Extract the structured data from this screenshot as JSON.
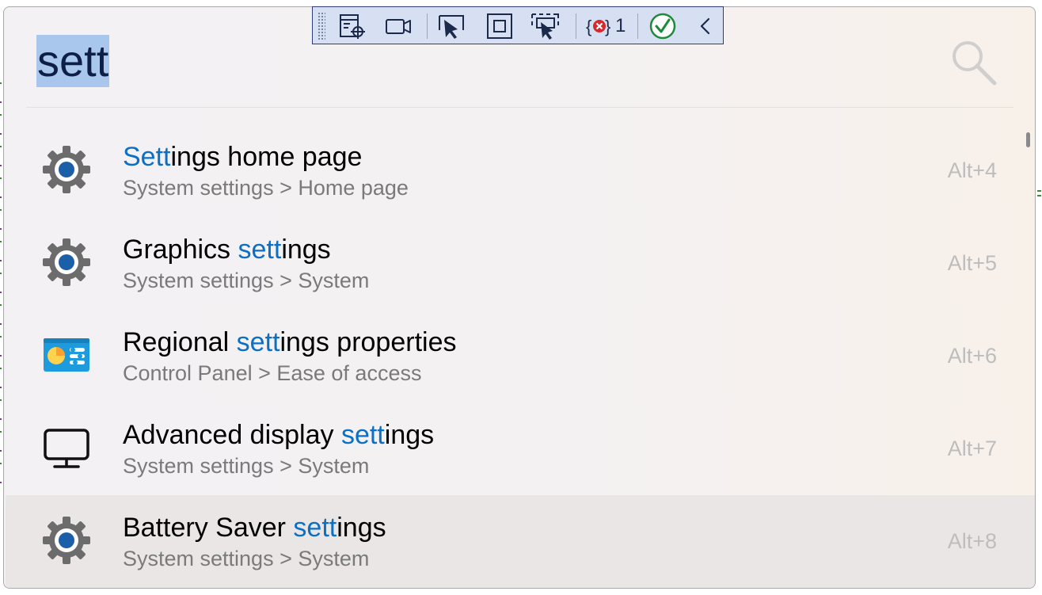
{
  "search": {
    "query": "sett"
  },
  "results": [
    {
      "title_match": "Sett",
      "title_rest": "ings home page",
      "subtitle": "System settings > Home page",
      "shortcut": "Alt+4",
      "icon": "gear-icon"
    },
    {
      "title_pre": "Graphics ",
      "title_match": "sett",
      "title_rest": "ings",
      "subtitle": "System settings > System",
      "shortcut": "Alt+5",
      "icon": "gear-icon"
    },
    {
      "title_pre": "Regional ",
      "title_match": "sett",
      "title_rest": "ings properties",
      "subtitle": "Control Panel > Ease of access",
      "shortcut": "Alt+6",
      "icon": "control-panel-icon"
    },
    {
      "title_pre": "Advanced display ",
      "title_match": "sett",
      "title_rest": "ings",
      "subtitle": "System settings > System",
      "shortcut": "Alt+7",
      "icon": "monitor-icon"
    },
    {
      "title_pre": "Battery Saver ",
      "title_match": "sett",
      "title_rest": "ings",
      "subtitle": "System settings > System",
      "shortcut": "Alt+8",
      "icon": "gear-icon",
      "selected": true
    }
  ],
  "toolbar": {
    "error_count": "1",
    "buttons": [
      "select-element-icon",
      "record-icon",
      "pointer-select-icon",
      "display-bounds-icon",
      "track-focus-icon",
      "binding-errors-icon",
      "checkmark-icon",
      "collapse-icon"
    ]
  },
  "colors": {
    "match_highlight": "#0b6fc6",
    "selection_bg": "#a9c7ec",
    "selected_row": "#ebe6e6"
  }
}
